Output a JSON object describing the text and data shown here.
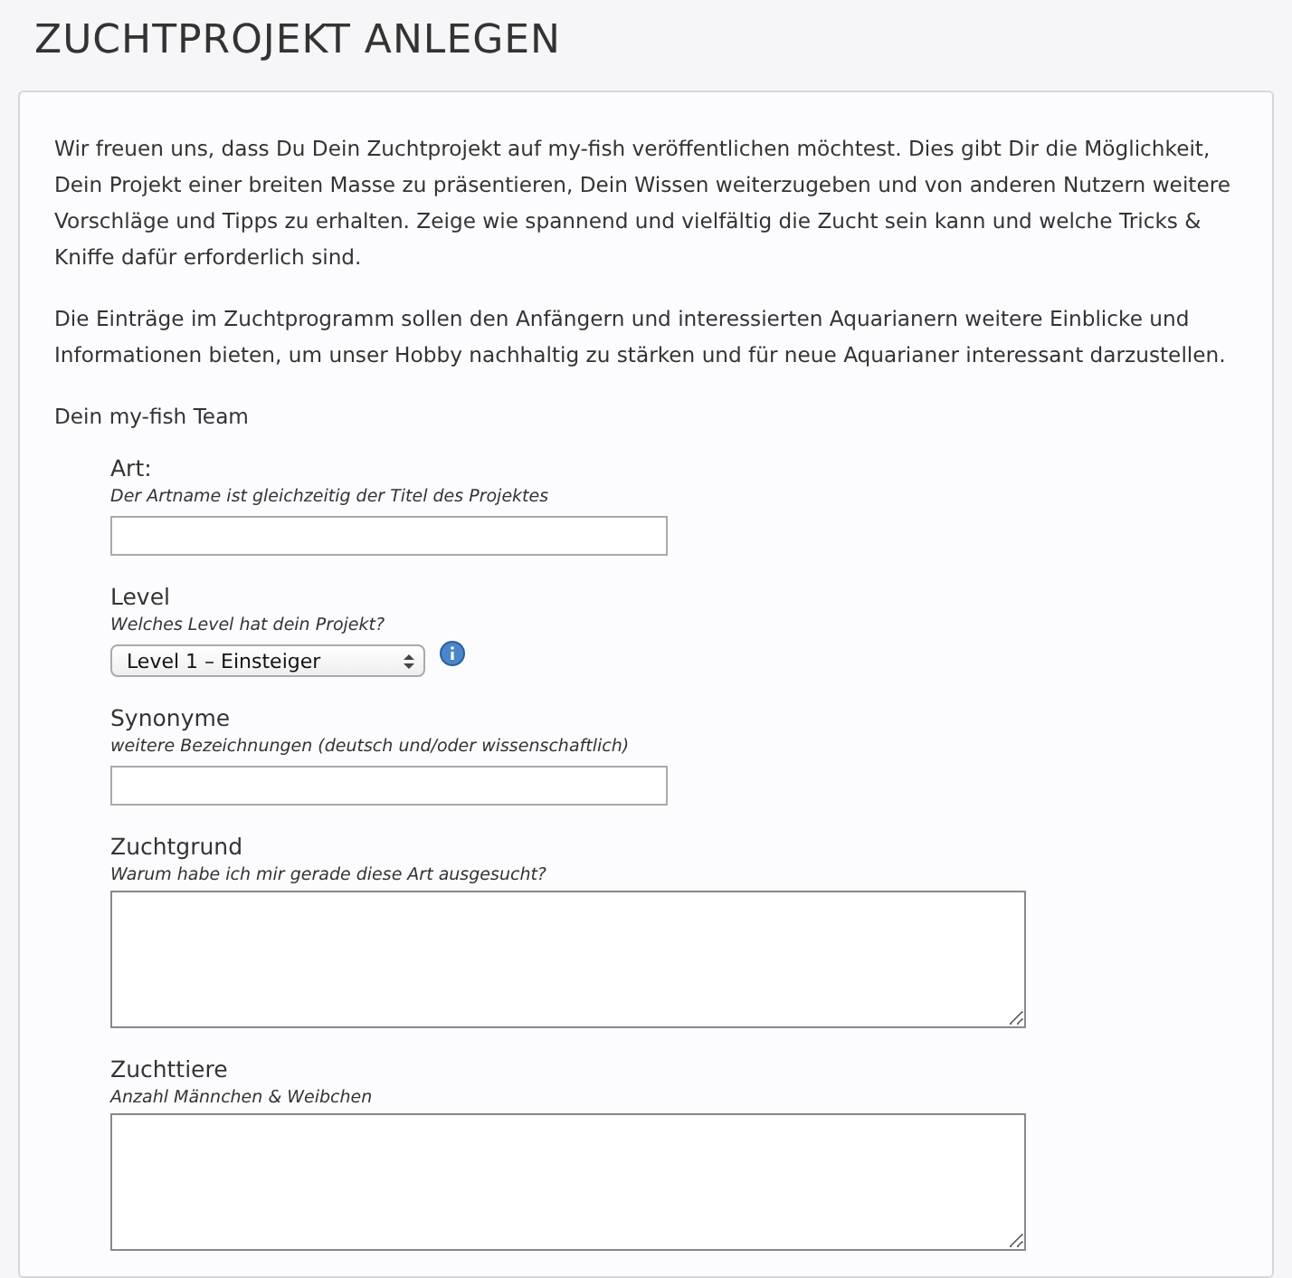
{
  "title": "ZUCHTPROJEKT ANLEGEN",
  "intro": [
    "Wir freuen uns, dass Du Dein Zuchtprojekt auf my-fish veröffentlichen möchtest. Dies gibt Dir die Möglichkeit, Dein Projekt einer breiten Masse zu präsentieren, Dein Wissen weiterzugeben und von anderen Nutzern weitere  Vorschläge und Tipps zu erhalten. Zeige wie spannend und vielfältig die Zucht sein kann und welche Tricks & Kniffe dafür erforderlich sind.",
    "Die Einträge im Zuchtprogramm sollen den Anfängern und interessierten Aquarianern weitere Einblicke und Informationen bieten, um unser Hobby nachhaltig zu stärken und für neue Aquarianer interessant darzustellen.",
    "Dein my-fish Team"
  ],
  "fields": [
    {
      "kind": "text",
      "label": "Art:",
      "hint": "Der Artname ist gleichzeitig der Titel des Projektes"
    },
    {
      "kind": "select",
      "label": "Level",
      "hint": "Welches Level hat dein Projekt?",
      "value": "Level 1 – Einsteiger",
      "info": true
    },
    {
      "kind": "text",
      "label": "Synonyme",
      "hint": "weitere Bezeichnungen (deutsch und/oder wissenschaftlich)"
    },
    {
      "kind": "textarea",
      "label": "Zuchtgrund",
      "hint": "Warum habe ich mir gerade diese Art ausgesucht?"
    },
    {
      "kind": "textarea",
      "label": "Zuchttiere",
      "hint": "Anzahl Männchen & Weibchen"
    }
  ]
}
